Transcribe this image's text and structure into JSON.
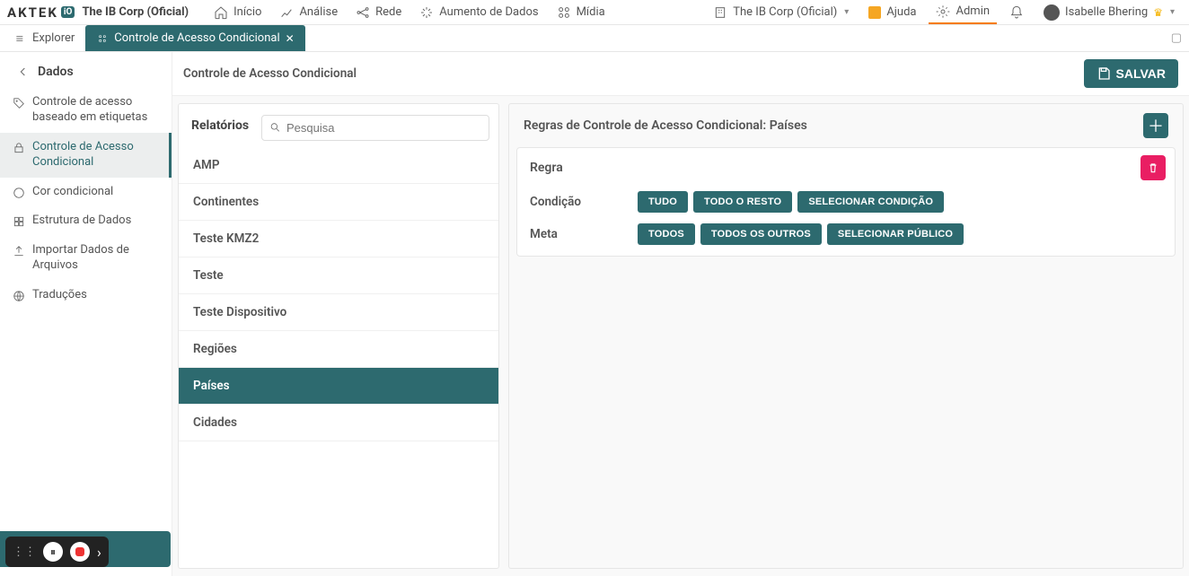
{
  "brand": {
    "name": "AKTEK",
    "suffix": "iO"
  },
  "org": "The IB Corp (Oficial)",
  "topnav": {
    "inicio": "Início",
    "analise": "Análise",
    "rede": "Rede",
    "aumento": "Aumento de Dados",
    "midia": "Mídia"
  },
  "topnav_right": {
    "org_select": "The IB Corp (Oficial)",
    "ajuda": "Ajuda",
    "admin": "Admin",
    "user": "Isabelle Bhering"
  },
  "tabs": {
    "explorer": "Explorer",
    "current": "Controle de Acesso Condicional"
  },
  "left": {
    "header": "Dados",
    "items": [
      "Controle de acesso baseado em etiquetas",
      "Controle de Acesso Condicional",
      "Cor condicional",
      "Estrutura de Dados",
      "Importar Dados de Arquivos",
      "Traduções"
    ]
  },
  "content": {
    "title": "Controle de Acesso Condicional",
    "save": "SALVAR"
  },
  "reports": {
    "tab": "Relatórios",
    "search_placeholder": "Pesquisa",
    "items": [
      "AMP",
      "Continentes",
      "Teste KMZ2",
      "Teste",
      "Teste Dispositivo",
      "Regiões",
      "Países",
      "Cidades"
    ],
    "active_index": 6
  },
  "rules": {
    "title_prefix": "Regras de Controle de Acesso Condicional: ",
    "title_target": "Países",
    "rule_heading": "Regra",
    "condicao_label": "Condição",
    "condicao_buttons": [
      "TUDO",
      "TODO O RESTO",
      "SELECIONAR CONDIÇÃO"
    ],
    "meta_label": "Meta",
    "meta_buttons": [
      "TODOS",
      "TODOS OS OUTROS",
      "SELECIONAR PÚBLICO"
    ]
  }
}
